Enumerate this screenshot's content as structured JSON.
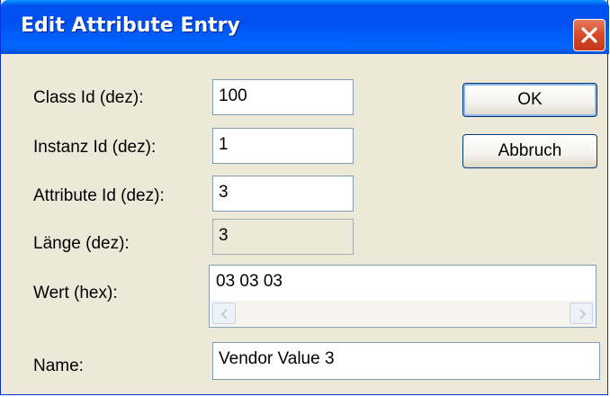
{
  "window": {
    "title": "Edit Attribute Entry"
  },
  "labels": {
    "class_id": "Class Id (dez):",
    "instanz_id": "Instanz Id (dez):",
    "attribute_id": "Attribute Id (dez):",
    "laenge": "Länge (dez):",
    "wert": "Wert (hex):",
    "name": "Name:"
  },
  "fields": {
    "class_id": "100",
    "instanz_id": "1",
    "attribute_id": "3",
    "laenge": "3",
    "wert": "03 03 03",
    "name": "Vendor Value 3"
  },
  "buttons": {
    "ok": "OK",
    "cancel": "Abbruch"
  },
  "icons": {
    "close": "close-icon",
    "scroll_left": "chevron-left-icon",
    "scroll_right": "chevron-right-icon"
  },
  "colors": {
    "titlebar": "#0054e3",
    "close_button": "#d64a28",
    "dialog_background": "#ece9d8"
  }
}
